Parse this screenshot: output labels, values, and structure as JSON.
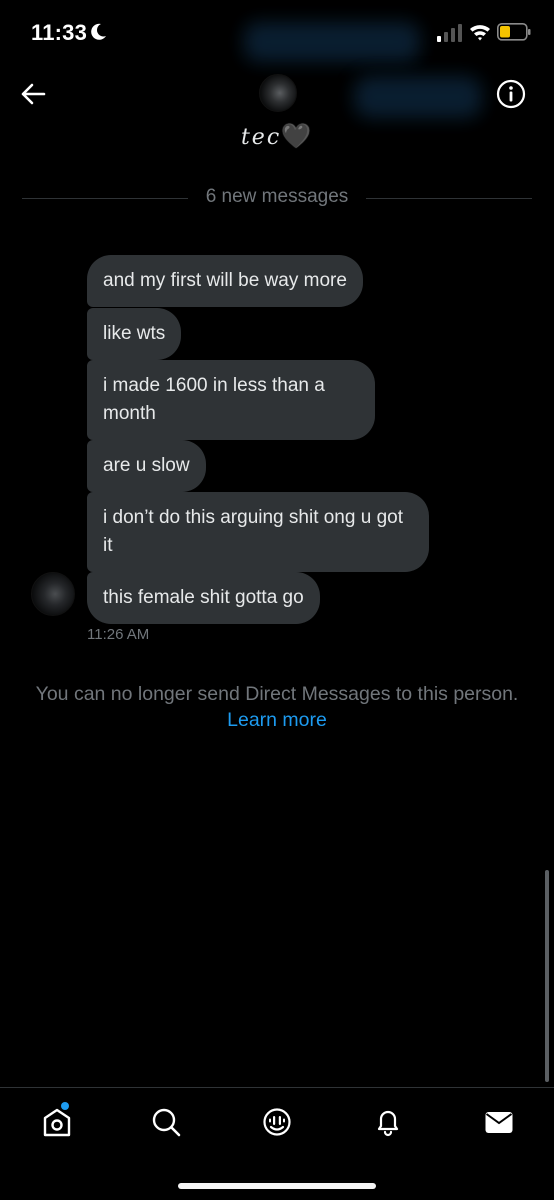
{
  "status": {
    "time": "11:33"
  },
  "header": {
    "name": "tec",
    "emoji": "🖤"
  },
  "divider": {
    "text": "6 new messages"
  },
  "messages": [
    {
      "text": "and my first will be way more"
    },
    {
      "text": "like wts"
    },
    {
      "text": "i made 1600 in less than a month"
    },
    {
      "text": "are u slow"
    },
    {
      "text": "i don’t do this arguing shit ong u got it"
    },
    {
      "text": "this female shit gotta go"
    }
  ],
  "timestamp": "11:26 AM",
  "notice": {
    "text": "You can no longer send Direct Messages to this person.",
    "link": "Learn more"
  },
  "colors": {
    "background": "#000000",
    "bubble": "#2f3336",
    "accent": "#1d9bf0",
    "muted": "#71767b",
    "battery": "#f5c400"
  },
  "icons": {
    "back": "arrow-left-icon",
    "info": "info-icon",
    "home": "home-icon",
    "search": "search-icon",
    "spaces": "spaces-icon",
    "notifications": "bell-icon",
    "messages": "mail-icon"
  }
}
